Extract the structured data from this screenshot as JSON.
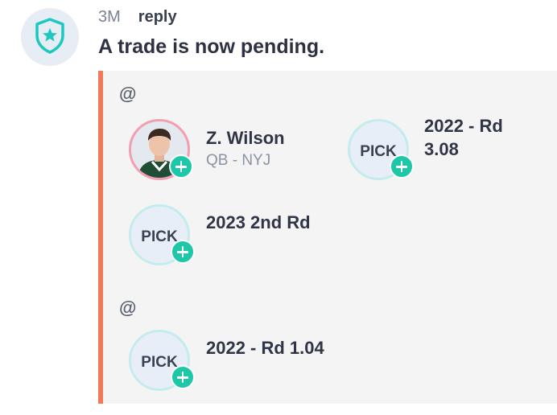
{
  "message": {
    "avatar_icon": "shield-star-icon",
    "time": "3M",
    "reply_label": "reply",
    "headline": "A trade is now pending."
  },
  "trade": {
    "side_a": {
      "mention": "@",
      "assets": [
        {
          "type": "player",
          "name": "Z. Wilson",
          "detail": "QB - NYJ"
        },
        {
          "type": "pick",
          "badge": "PICK",
          "label_line1": "2022 - Rd",
          "label_line2": "3.08"
        },
        {
          "type": "pick",
          "badge": "PICK",
          "label": "2023 2nd Rd"
        }
      ]
    },
    "side_b": {
      "mention": "@",
      "assets": [
        {
          "type": "pick",
          "badge": "PICK",
          "label": "2022 - Rd 1.04"
        }
      ]
    }
  },
  "colors": {
    "accent_border": "#f0795a",
    "plus_badge": "#1ec7a8",
    "player_ring": "#f39db0",
    "pick_ring": "#c5ecec"
  }
}
